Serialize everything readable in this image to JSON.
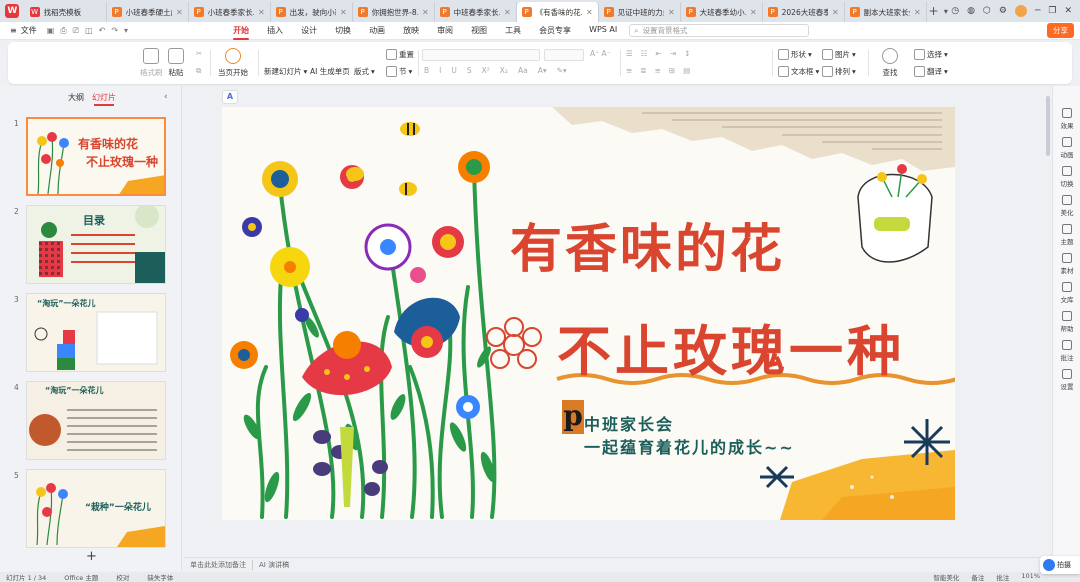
{
  "tabs": [
    {
      "label": "找稻壳模板",
      "icon": "wps-logo-icon",
      "type": "w"
    },
    {
      "label": "小班春季硬土成…",
      "icon": "ppt-file-icon",
      "type": "p"
    },
    {
      "label": "小班春季家长…",
      "icon": "ppt-file-icon",
      "type": "p"
    },
    {
      "label": "出发，驶向小班…",
      "icon": "ppt-file-icon",
      "type": "p"
    },
    {
      "label": "你拥抱世界-8…",
      "icon": "ppt-file-icon",
      "type": "p"
    },
    {
      "label": "中班春季家长…",
      "icon": "ppt-file-icon",
      "type": "p"
    },
    {
      "label": "《有香味的花…",
      "icon": "ppt-file-icon",
      "type": "p",
      "active": true
    },
    {
      "label": "见证中班的力量…",
      "icon": "ppt-file-icon",
      "type": "p"
    },
    {
      "label": "大班春季幼小…",
      "icon": "ppt-file-icon",
      "type": "p"
    },
    {
      "label": "2026大班春季…",
      "icon": "ppt-file-icon",
      "type": "p"
    },
    {
      "label": "副本大班家长会…",
      "icon": "ppt-file-icon",
      "type": "p"
    }
  ],
  "menubar": {
    "file_label": "文件",
    "tabs": [
      "开始",
      "插入",
      "设计",
      "切换",
      "动画",
      "放映",
      "审阅",
      "视图",
      "工具",
      "会员专享",
      "WPS AI"
    ],
    "active_tab": "开始",
    "search_placeholder": "设置背景格式",
    "share_label": "分享"
  },
  "ribbon": {
    "format_painter": "格式刷",
    "paste": "粘贴",
    "play_from_current": "当页开始",
    "new_slide": "新建幻灯片",
    "ai_generate": "AI 生成单页",
    "layout": "版式",
    "section": "节",
    "reset": "重置",
    "shape": "形状",
    "picture": "图片",
    "textbox": "文本框",
    "arrange": "排列",
    "find": "查找",
    "select": "选择",
    "translate": "翻译"
  },
  "left_panel": {
    "tabs": [
      "大纲",
      "幻灯片"
    ],
    "active_tab": "幻灯片",
    "slides": [
      {
        "num": "1",
        "title": "有香味的花 不止玫瑰一种"
      },
      {
        "num": "2",
        "title": "目录"
      },
      {
        "num": "3",
        "title": "“淘玩”一朵花儿"
      },
      {
        "num": "4",
        "title": "“淘玩”一朵花儿"
      },
      {
        "num": "5",
        "title": "“栽种”一朵花儿"
      }
    ]
  },
  "slide": {
    "title_line1": "有香味的花",
    "title_line2": "不止玫瑰一种",
    "logo_letter": "p",
    "subtitle_line1": "中班家长会",
    "subtitle_line2": "一起蕴育着花儿的成长~~",
    "accent_color": "#d9452f",
    "teal_color": "#1b5e5a"
  },
  "notes_placeholder": "单击此处添加备注",
  "ai_notes": "AI 演讲稿",
  "right_sidebar": [
    "效果",
    "动画",
    "切换",
    "美化",
    "主题",
    "素材",
    "文库",
    "帮助",
    "批注",
    "设置"
  ],
  "statusbar": {
    "slide_count": "幻灯片 1 / 34",
    "theme": "Office 主题",
    "proofread": "校对",
    "missing_font": "缺失字体",
    "smart_beautify": "智能美化",
    "notes": "备注",
    "comments": "批注",
    "zoom": "101%"
  },
  "float_button": "拍摄"
}
